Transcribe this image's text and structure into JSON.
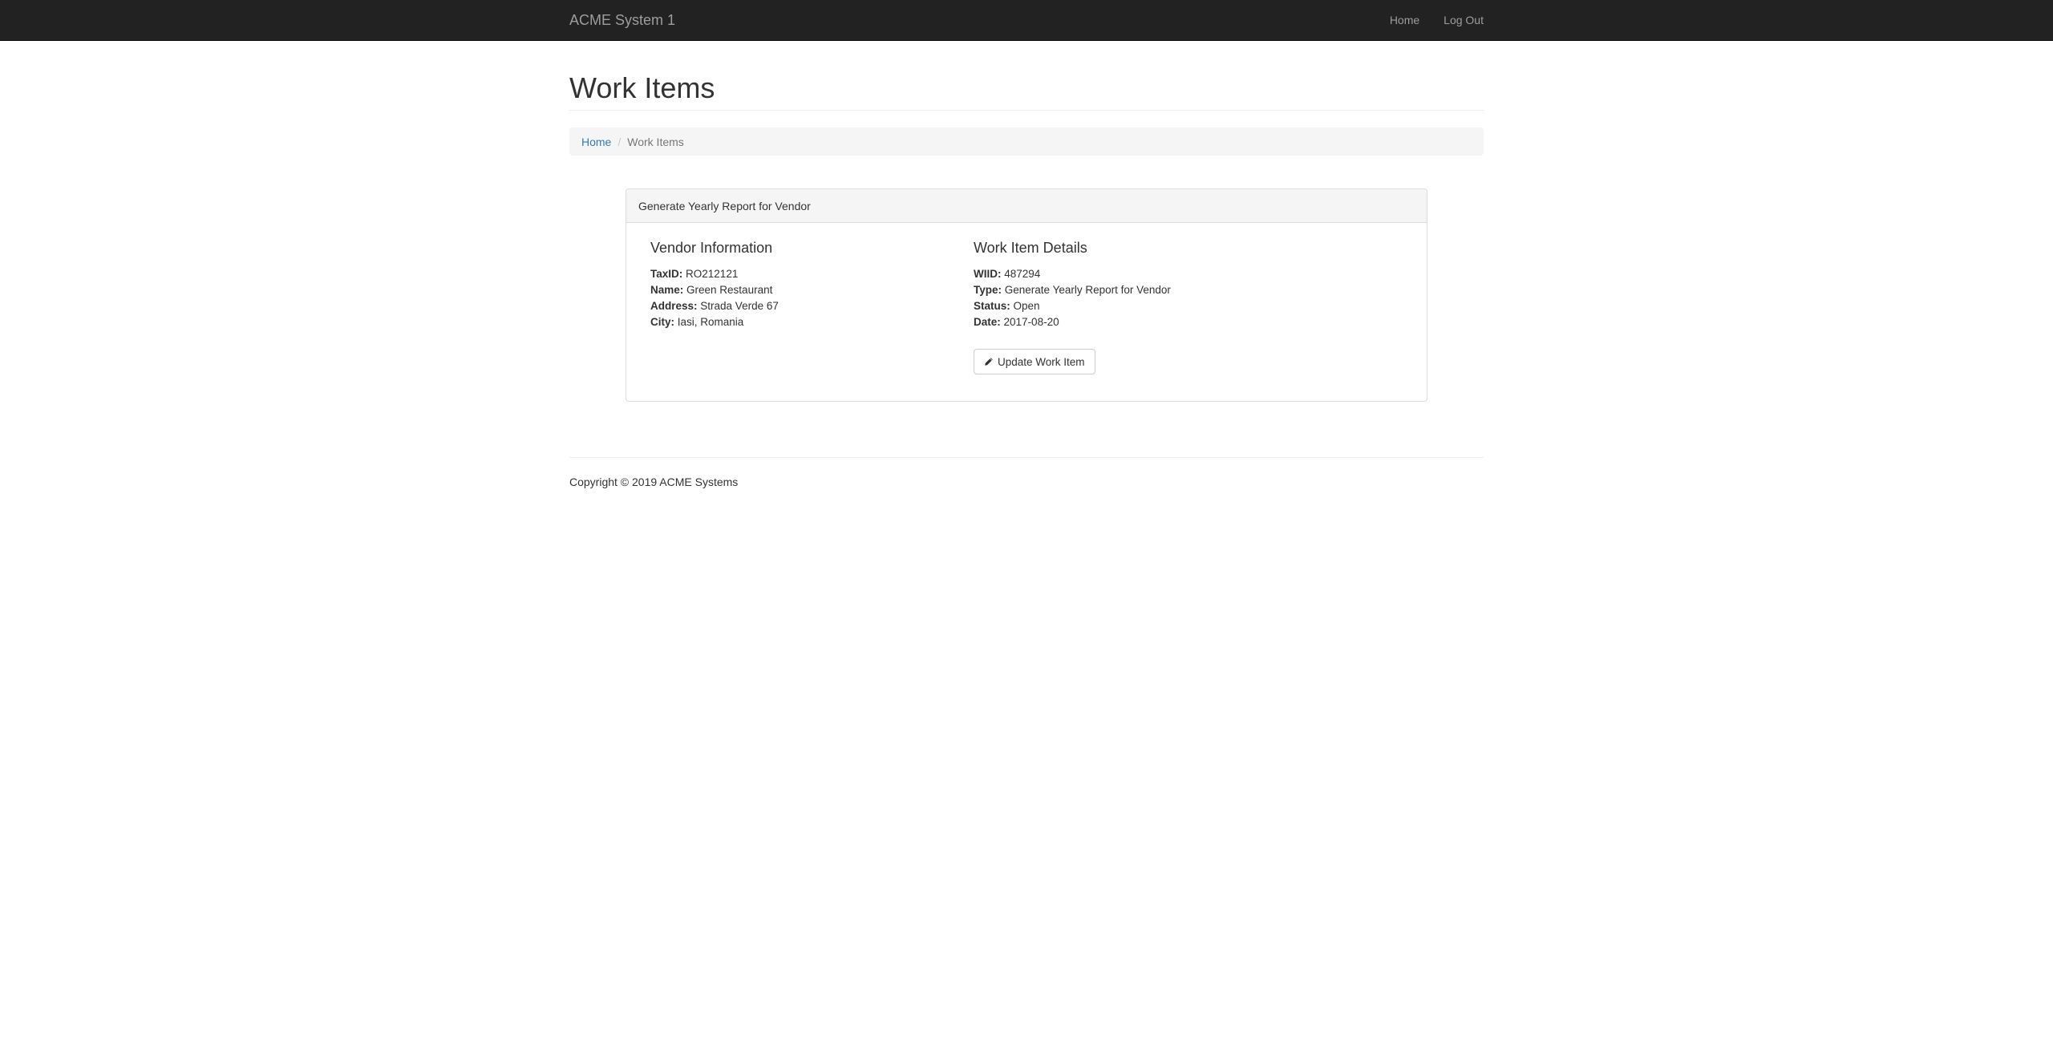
{
  "navbar": {
    "brand": "ACME System 1",
    "links": [
      {
        "label": "Home"
      },
      {
        "label": "Log Out"
      }
    ]
  },
  "page": {
    "title": "Work Items"
  },
  "breadcrumb": {
    "home": "Home",
    "separator": "/",
    "current": "Work Items"
  },
  "panel": {
    "heading": "Generate Yearly Report for Vendor",
    "vendor": {
      "title": "Vendor Information",
      "fields": [
        {
          "label": "TaxID:",
          "value": "RO212121"
        },
        {
          "label": "Name:",
          "value": "Green Restaurant"
        },
        {
          "label": "Address:",
          "value": "Strada Verde 67"
        },
        {
          "label": "City:",
          "value": "Iasi, Romania"
        }
      ]
    },
    "work_item": {
      "title": "Work Item Details",
      "fields": [
        {
          "label": "WIID:",
          "value": "487294"
        },
        {
          "label": "Type:",
          "value": "Generate Yearly Report for Vendor"
        },
        {
          "label": "Status:",
          "value": "Open"
        },
        {
          "label": "Date:",
          "value": "2017-08-20"
        }
      ]
    },
    "button_label": "Update Work Item",
    "button_icon": "pencil-icon"
  },
  "footer": {
    "copyright": "Copyright © 2019 ACME Systems"
  },
  "colors": {
    "navbar_bg": "#222222",
    "navbar_text": "#9d9d9d",
    "link": "#337ab7",
    "panel_heading_bg": "#f5f5f5"
  }
}
